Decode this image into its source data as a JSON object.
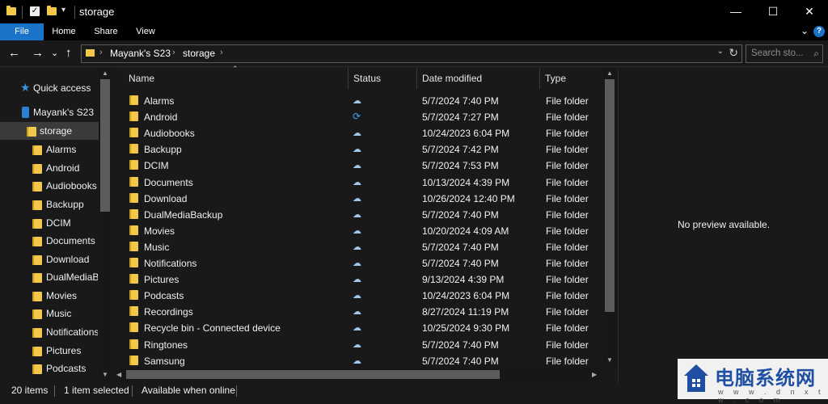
{
  "window": {
    "title": "storage",
    "controls": [
      "—",
      "☐",
      "✕"
    ]
  },
  "ribbon": {
    "tabs": [
      "File",
      "Home",
      "Share",
      "View"
    ],
    "help": "?"
  },
  "address": {
    "crumbs": [
      "Mayank's S23",
      "storage"
    ],
    "search_placeholder": "Search sto..."
  },
  "sidebar": {
    "quick_access": "Quick access",
    "device": "Mayank's S23",
    "selected": "storage",
    "items": [
      "Alarms",
      "Android",
      "Audiobooks",
      "Backupp",
      "DCIM",
      "Documents",
      "Download",
      "DualMediaBa",
      "Movies",
      "Music",
      "Notifications",
      "Pictures",
      "Podcasts"
    ]
  },
  "columns": [
    "Name",
    "Status",
    "Date modified",
    "Type"
  ],
  "files": [
    {
      "name": "Alarms",
      "status": "cloud",
      "date": "5/7/2024 7:40 PM",
      "type": "File folder"
    },
    {
      "name": "Android",
      "status": "sync",
      "date": "5/7/2024 7:27 PM",
      "type": "File folder"
    },
    {
      "name": "Audiobooks",
      "status": "cloud",
      "date": "10/24/2023 6:04 PM",
      "type": "File folder"
    },
    {
      "name": "Backupp",
      "status": "cloud",
      "date": "5/7/2024 7:42 PM",
      "type": "File folder"
    },
    {
      "name": "DCIM",
      "status": "cloud",
      "date": "5/7/2024 7:53 PM",
      "type": "File folder"
    },
    {
      "name": "Documents",
      "status": "cloud",
      "date": "10/13/2024 4:39 PM",
      "type": "File folder"
    },
    {
      "name": "Download",
      "status": "cloud",
      "date": "10/26/2024 12:40 PM",
      "type": "File folder"
    },
    {
      "name": "DualMediaBackup",
      "status": "cloud",
      "date": "5/7/2024 7:40 PM",
      "type": "File folder"
    },
    {
      "name": "Movies",
      "status": "cloud",
      "date": "10/20/2024 4:09 AM",
      "type": "File folder"
    },
    {
      "name": "Music",
      "status": "cloud",
      "date": "5/7/2024 7:40 PM",
      "type": "File folder"
    },
    {
      "name": "Notifications",
      "status": "cloud",
      "date": "5/7/2024 7:40 PM",
      "type": "File folder"
    },
    {
      "name": "Pictures",
      "status": "cloud",
      "date": "9/13/2024 4:39 PM",
      "type": "File folder"
    },
    {
      "name": "Podcasts",
      "status": "cloud",
      "date": "10/24/2023 6:04 PM",
      "type": "File folder"
    },
    {
      "name": "Recordings",
      "status": "cloud",
      "date": "8/27/2024 11:19 PM",
      "type": "File folder"
    },
    {
      "name": "Recycle bin - Connected device",
      "status": "cloud",
      "date": "10/25/2024 9:30 PM",
      "type": "File folder"
    },
    {
      "name": "Ringtones",
      "status": "cloud",
      "date": "5/7/2024 7:40 PM",
      "type": "File folder"
    },
    {
      "name": "Samsung",
      "status": "cloud",
      "date": "5/7/2024 7:40 PM",
      "type": "File folder"
    }
  ],
  "preview": {
    "message": "No preview available."
  },
  "status": {
    "count": "20 items",
    "selected": "1 item selected",
    "availability": "Available when online"
  },
  "watermark": {
    "text": "电脑系统网",
    "url": "w w w . d n x t w . c o m"
  },
  "colors": {
    "accent": "#1a73c9",
    "folder": "#f3c84a",
    "background": "#191919"
  }
}
